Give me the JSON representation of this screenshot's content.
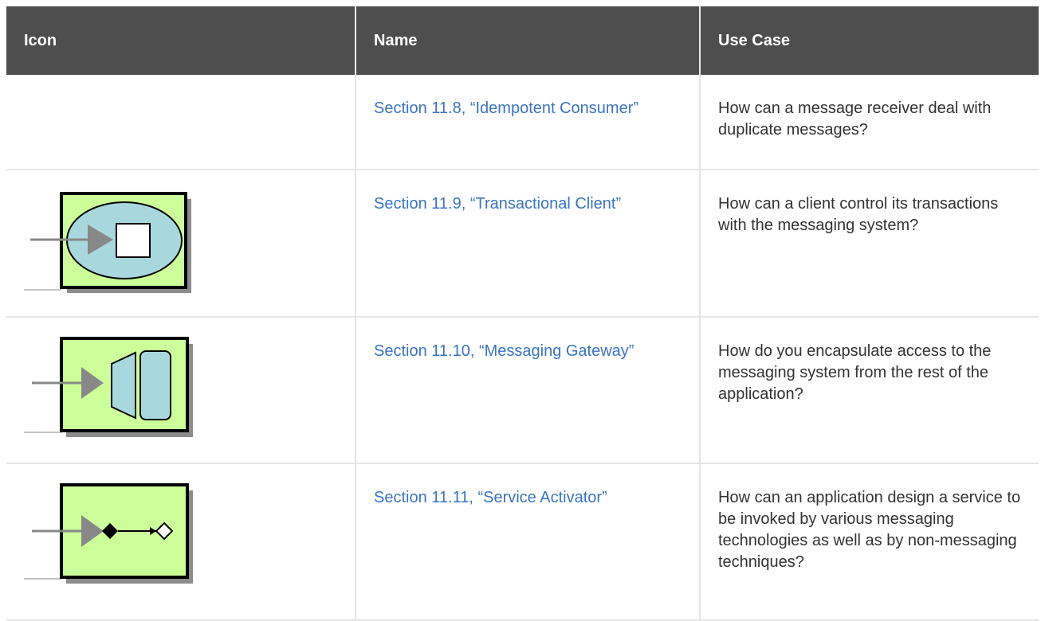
{
  "table": {
    "headers": {
      "icon": "Icon",
      "name": "Name",
      "use_case": "Use Case"
    },
    "rows": [
      {
        "icon": "",
        "name": "Section 11.8, “Idempotent Consumer”",
        "use_case": "How can a message receiver deal with duplicate messages?"
      },
      {
        "icon": "transactional-client-icon",
        "name": "Section 11.9, “Transactional Client”",
        "use_case": "How can a client control its transactions with the messaging system?"
      },
      {
        "icon": "messaging-gateway-icon",
        "name": "Section 11.10, “Messaging Gateway”",
        "use_case": "How do you encapsulate access to the messaging system from the rest of the application?"
      },
      {
        "icon": "service-activator-icon",
        "name": "Section 11.11, “Service Activator”",
        "use_case": "How can an application design a service to be invoked by various messaging technologies as well as by non-messaging techniques?"
      }
    ]
  },
  "colors": {
    "header_bg": "#4e4e4e",
    "link": "#3a74c4",
    "icon_fill": "#ccff99",
    "icon_shape_fill": "#a8d8de"
  }
}
